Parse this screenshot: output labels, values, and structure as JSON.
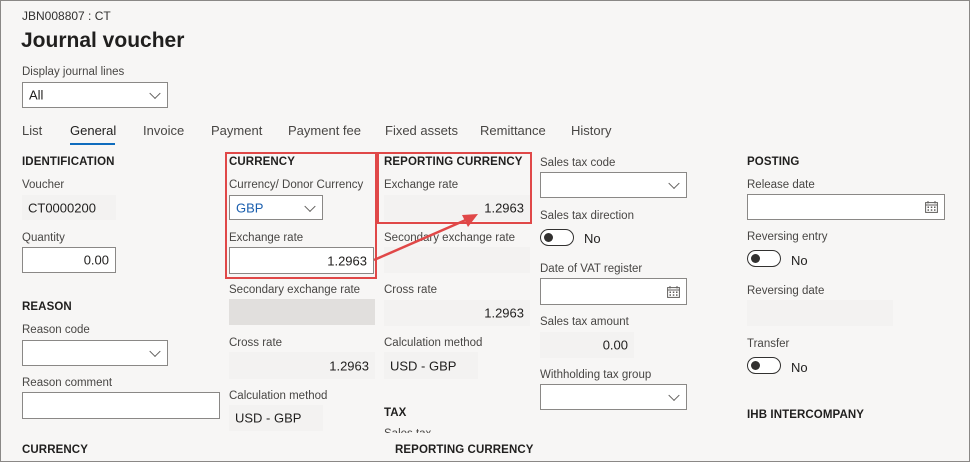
{
  "header": {
    "breadcrumb": "JBN008807 : CT",
    "title": "Journal voucher"
  },
  "display_journal_lines": {
    "label": "Display journal lines",
    "value": "All"
  },
  "tabs": [
    "List",
    "General",
    "Invoice",
    "Payment",
    "Payment fee",
    "Fixed assets",
    "Remittance",
    "History"
  ],
  "identification": {
    "heading": "IDENTIFICATION",
    "voucher_label": "Voucher",
    "voucher_value": "CT0000200",
    "quantity_label": "Quantity",
    "quantity_value": "0.00"
  },
  "reason": {
    "heading": "REASON",
    "code_label": "Reason code",
    "code_value": "",
    "comment_label": "Reason comment",
    "comment_value": ""
  },
  "currency_bottom": {
    "heading": "CURRENCY"
  },
  "currency": {
    "heading": "CURRENCY",
    "donor_label": "Currency/ Donor Currency",
    "donor_value": "GBP",
    "exchange_label": "Exchange rate",
    "exchange_value": "1.2963",
    "secondary_label": "Secondary exchange rate",
    "secondary_value": "",
    "cross_label": "Cross rate",
    "cross_value": "1.2963",
    "calc_label": "Calculation method",
    "calc_value": "USD - GBP"
  },
  "reporting_currency": {
    "heading": "REPORTING CURRENCY",
    "exchange_label": "Exchange rate",
    "exchange_value": "1.2963",
    "secondary_label": "Secondary exchange rate",
    "secondary_value": "",
    "cross_label": "Cross rate",
    "cross_value": "1.2963",
    "calc_label": "Calculation method",
    "calc_value": "USD - GBP"
  },
  "tax": {
    "heading": "TAX",
    "partial_label": "Sales tax"
  },
  "reporting_currency_bottom": {
    "heading": "REPORTING CURRENCY"
  },
  "sales_tax": {
    "code_label": "Sales tax code",
    "code_value": "",
    "direction_label": "Sales tax direction",
    "direction_value": "No",
    "vat_date_label": "Date of VAT register",
    "vat_date_value": "",
    "amount_label": "Sales tax amount",
    "amount_value": "0.00",
    "withholding_label": "Withholding tax group",
    "withholding_value": ""
  },
  "posting": {
    "heading": "POSTING",
    "release_label": "Release date",
    "release_value": "",
    "reversing_entry_label": "Reversing entry",
    "reversing_entry_value": "No",
    "reversing_date_label": "Reversing date",
    "reversing_date_value": "",
    "transfer_label": "Transfer",
    "transfer_value": "No"
  },
  "ihb": {
    "heading": "IHB INTERCOMPANY"
  },
  "colors": {
    "accent": "#0f6cbd",
    "highlight": "#e04848",
    "background": "#f7f6f5"
  }
}
